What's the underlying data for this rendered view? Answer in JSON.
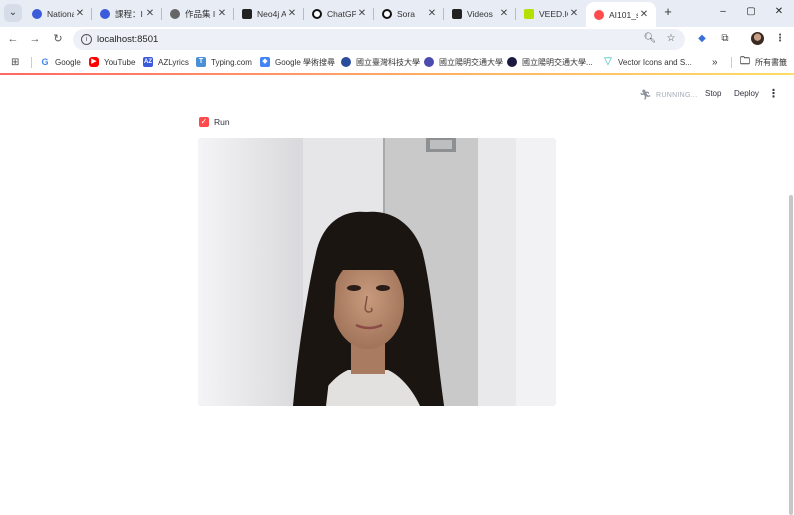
{
  "browser": {
    "tabs": [
      {
        "label": "Nationa",
        "favicon": "globe-icon",
        "color": "#3b5bdb",
        "active": false
      },
      {
        "label": "課程：I",
        "favicon": "globe-icon",
        "color": "#3b5bdb",
        "active": false
      },
      {
        "label": "作品集 I",
        "favicon": "globe-icon",
        "color": "#555555",
        "active": false
      },
      {
        "label": "Neo4j A",
        "favicon": "neo4j-icon",
        "color": "#222222",
        "active": false
      },
      {
        "label": "ChatGP",
        "favicon": "chatgpt-icon",
        "color": "#111111",
        "active": false
      },
      {
        "label": "Sora",
        "favicon": "sora-icon",
        "color": "#111111",
        "active": false
      },
      {
        "label": "Videos",
        "favicon": "videos-icon",
        "color": "#222222",
        "active": false
      },
      {
        "label": "VEED.IO",
        "favicon": "veed-icon",
        "color": "#b3e000",
        "active": false
      },
      {
        "label": "AI101_s",
        "favicon": "streamlit-icon",
        "color": "#ff4b4b",
        "active": true
      }
    ],
    "new_tab_symbol": "+",
    "window_controls": {
      "minimize": "–",
      "maximize": "▢",
      "close": "✕"
    },
    "address": {
      "url": "localhost:8501"
    },
    "bookmarks": [
      {
        "label": "",
        "icon": "apps-grid-icon",
        "color": "#333333"
      },
      {
        "label": "Google",
        "icon": "google-icon",
        "color": "#4285f4"
      },
      {
        "label": "YouTube",
        "icon": "youtube-icon",
        "color": "#ff0000"
      },
      {
        "label": "AZLyrics",
        "icon": "azlyrics-icon",
        "color": "#3b5bdb"
      },
      {
        "label": "Typing.com",
        "icon": "typing-icon",
        "color": "#4a90d9"
      },
      {
        "label": "Google 學術搜尋",
        "icon": "scholar-icon",
        "color": "#4285f4"
      },
      {
        "label": "國立臺灣科技大學",
        "icon": "ntust-icon",
        "color": "#2b4c9b"
      },
      {
        "label": "國立陽明交通大學",
        "icon": "nycu-icon",
        "color": "#4b4bb0"
      },
      {
        "label": "國立陽明交通大學...",
        "icon": "nycu-dark-icon",
        "color": "#1a1a40"
      },
      {
        "label": "Vector Icons and S...",
        "icon": "vector-icon",
        "color": "#1bb5b5"
      }
    ],
    "more_bookmarks_symbol": "»",
    "all_bookmarks_label": "所有書籤"
  },
  "app": {
    "status_text": "RUNNING...",
    "stop_label": "Stop",
    "deploy_label": "Deploy",
    "menu_symbol": "⋮",
    "checkbox": {
      "label": "Run",
      "checked": true,
      "accent": "#ff4b4b"
    }
  }
}
